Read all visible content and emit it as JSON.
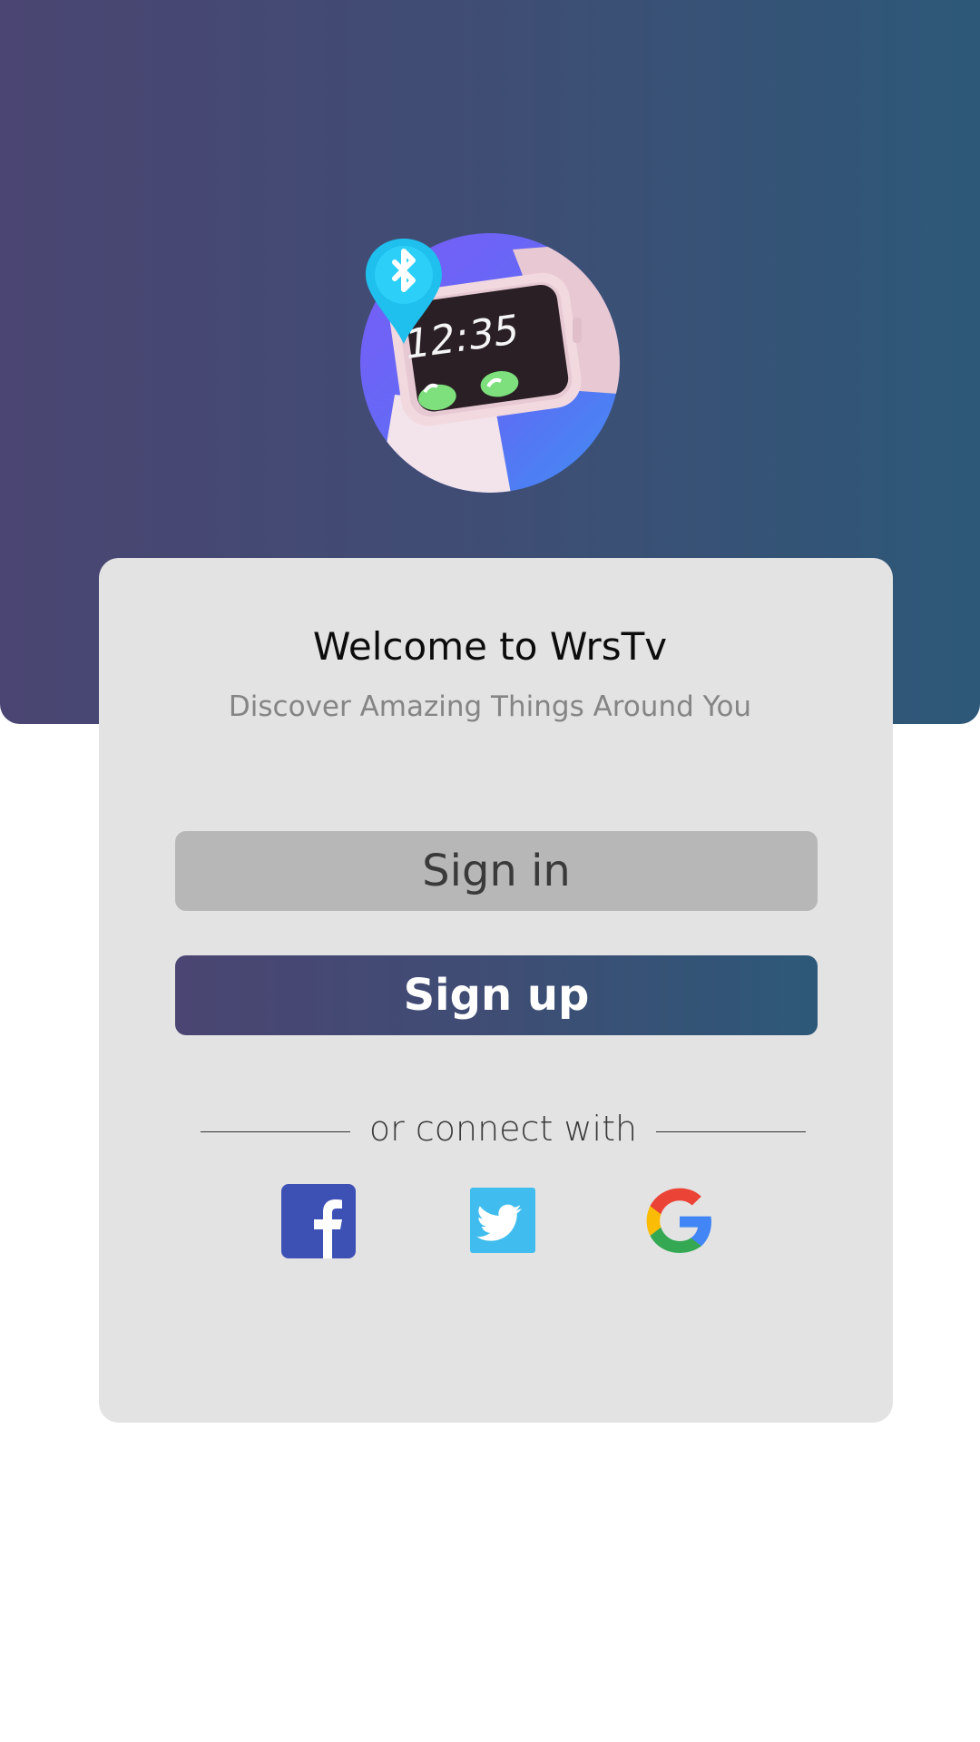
{
  "logo": {
    "name": "smartwatch-bluetooth-logo",
    "watch_time": "12:35",
    "colors": {
      "circle": "#6b63f5",
      "pin": "#1fbfee",
      "watch_body": "#f2d9e0",
      "screen": "#2a1f25",
      "call_buttons": "#7de07d"
    }
  },
  "welcome": {
    "title": "Welcome to WrsTv",
    "subtitle": "Discover Amazing Things Around You"
  },
  "buttons": {
    "signin_label": "Sign in",
    "signup_label": "Sign up"
  },
  "social": {
    "divider_text": "or connect with",
    "providers": [
      {
        "icon": "facebook-icon",
        "color": "#3d51b5"
      },
      {
        "icon": "twitter-icon",
        "color": "#40bdee"
      },
      {
        "icon": "google-icon",
        "color": "#4285f4"
      }
    ]
  },
  "theme": {
    "gradient_start": "#4a4572",
    "gradient_end": "#2d5878",
    "card_bg": "#e3e3e4"
  }
}
